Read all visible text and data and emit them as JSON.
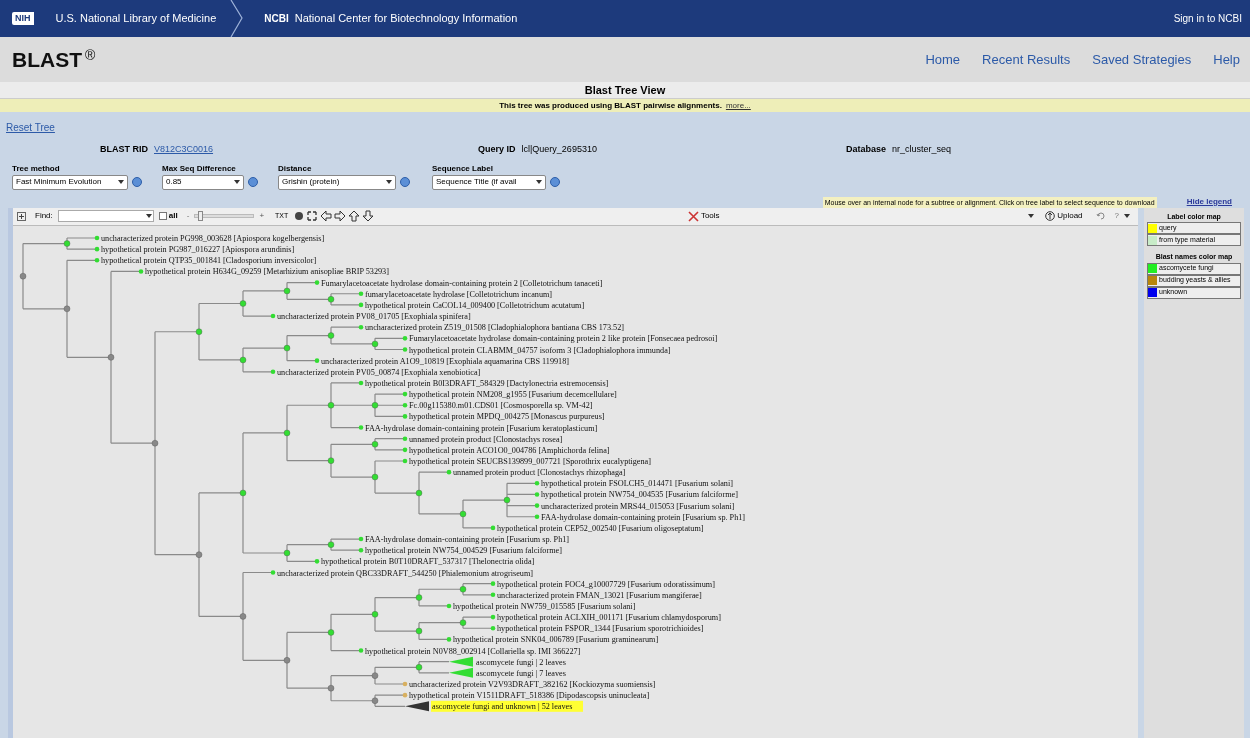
{
  "header": {
    "logo": "NIH",
    "library": "U.S. National Library of Medicine",
    "ncbi": "NCBI",
    "ncbi_name": "National Center for Biotechnology Information",
    "sign_in": "Sign in to NCBI"
  },
  "app": {
    "title": "BLAST",
    "mark": "®",
    "nav": [
      "Home",
      "Recent Results",
      "Saved Strategies",
      "Help"
    ]
  },
  "page_title": "Blast Tree View",
  "notice": {
    "text": "This tree was produced using BLAST pairwise alignments.",
    "link": "more..."
  },
  "reset": "Reset Tree",
  "info": [
    {
      "label": "BLAST RID",
      "value": "V812C3C0016",
      "kind": "link"
    },
    {
      "label": "Query ID",
      "value": "lcl|Query_2695310",
      "kind": "text"
    },
    {
      "label": "Database",
      "value": "nr_cluster_seq",
      "kind": "text"
    }
  ],
  "options": [
    {
      "label": "Tree method",
      "value": "Fast Minimum Evolution"
    },
    {
      "label": "Max Seq Difference",
      "value": "0.85"
    },
    {
      "label": "Distance",
      "value": "Grishin (protein)"
    },
    {
      "label": "Sequence Label",
      "value": "Sequence Title (if avail"
    }
  ],
  "toolbar": {
    "find_label": "Find:",
    "all_label": "all",
    "all_checked": false,
    "zoom_minus": "-",
    "zoom_plus": "+",
    "zoom": {
      "level": 0.05
    },
    "txt": "TXT",
    "hint": "Mouse over an internal node for a subtree or alignment. Click on tree label to select sequence to download",
    "hide_legend": "Hide legend",
    "tools": "Tools",
    "upload": "Upload",
    "help": "?"
  },
  "tree": {
    "color": "#888888",
    "children": [
      {
        "color": "#33dd33",
        "children": [
          {
            "label": "uncharacterized protein PG998_003628 [Apiospora kogelbergensis]",
            "color": "#33dd33",
            "query": false
          },
          {
            "label": "hypothetical protein PG987_016227 [Apiospora arundinis]",
            "color": "#33dd33",
            "query": false
          }
        ]
      },
      {
        "color": "#888888",
        "children": [
          {
            "label": "hypothetical protein QTP35_001841 [Cladosporium inversicolor]",
            "color": "#33dd33",
            "query": false
          },
          {
            "color": "#888888",
            "children": [
              {
                "label": "hypothetical protein H634G_09259 [Metarhizium anisopliae BRIP 53293]",
                "color": "#33dd33",
                "query": false
              },
              {
                "color": "#888888",
                "children": [
                  {
                    "color": "#33dd33",
                    "children": [
                      {
                        "color": "#33dd33",
                        "children": [
                          {
                            "color": "#33dd33",
                            "children": [
                              {
                                "label": "Fumarylacetoacetate hydrolase domain-containing protein 2 [Colletotrichum tanaceti]",
                                "color": "#33dd33",
                                "query": false
                              },
                              {
                                "color": "#33dd33",
                                "children": [
                                  {
                                    "label": "fumarylacetoacetate hydrolase [Colletotrichum incanum]",
                                    "color": "#33dd33",
                                    "query": false
                                  },
                                  {
                                    "label": "hypothetical protein CaCOL14_009400 [Colletotrichum acutatum]",
                                    "color": "#33dd33",
                                    "query": false
                                  }
                                ]
                              }
                            ]
                          },
                          {
                            "label": "uncharacterized protein PV08_01705 [Exophiala spinifera]",
                            "color": "#33dd33",
                            "query": false
                          }
                        ]
                      },
                      {
                        "color": "#33dd33",
                        "children": [
                          {
                            "color": "#33dd33",
                            "children": [
                              {
                                "color": "#33dd33",
                                "children": [
                                  {
                                    "label": "uncharacterized protein Z519_01508 [Cladophialophora bantiana CBS 173.52]",
                                    "color": "#33dd33",
                                    "query": false
                                  },
                                  {
                                    "color": "#33dd33",
                                    "children": [
                                      {
                                        "label": "Fumarylacetoacetate hydrolase domain-containing protein 2 like protein [Fonsecaea pedrosoi]",
                                        "color": "#33dd33",
                                        "query": false
                                      },
                                      {
                                        "label": "hypothetical protein CLABMM_04757 isoform 3 [Cladophialophora immunda]",
                                        "color": "#33dd33",
                                        "query": false
                                      }
                                    ]
                                  }
                                ]
                              },
                              {
                                "label": "uncharacterized protein A1O9_10819 [Exophiala aquamarina CBS 119918]",
                                "color": "#33dd33",
                                "query": false
                              }
                            ]
                          },
                          {
                            "label": "uncharacterized protein PV05_00874 [Exophiala xenobiotica]",
                            "color": "#33dd33",
                            "query": false
                          }
                        ]
                      }
                    ]
                  },
                  {
                    "color": "#888888",
                    "children": [
                      {
                        "color": "#33dd33",
                        "children": [
                          {
                            "color": "#33dd33",
                            "children": [
                              {
                                "color": "#33dd33",
                                "children": [
                                  {
                                    "label": "hypothetical protein B0I3DRAFT_584329 [Dactylonectria estremocensis]",
                                    "color": "#33dd33",
                                    "query": false
                                  },
                                  {
                                    "color": "#33dd33",
                                    "children": [
                                      {
                                        "label": "hypothetical protein NM208_g1955 [Fusarium decemcellulare]",
                                        "color": "#33dd33",
                                        "query": false
                                      },
                                      {
                                        "label": "Fc.00g115380.m01.CDS01 [Cosmosporella sp. VM-42]",
                                        "color": "#33dd33",
                                        "query": false
                                      },
                                      {
                                        "label": "hypothetical protein MPDQ_004275 [Monascus purpureus]",
                                        "color": "#33dd33",
                                        "query": false
                                      }
                                    ]
                                  },
                                  {
                                    "label": "FAA-hydrolase domain-containing protein [Fusarium keratoplasticum]",
                                    "color": "#33dd33",
                                    "query": false
                                  }
                                ]
                              },
                              {
                                "color": "#33dd33",
                                "children": [
                                  {
                                    "color": "#33dd33",
                                    "children": [
                                      {
                                        "label": "unnamed protein product [Clonostachys rosea]",
                                        "color": "#33dd33",
                                        "query": false
                                      },
                                      {
                                        "label": "hypothetical protein ACO1O0_004786 [Amphichorda felina]",
                                        "color": "#33dd33",
                                        "query": false
                                      }
                                    ]
                                  },
                                  {
                                    "color": "#33dd33",
                                    "children": [
                                      {
                                        "label": "hypothetical protein SEUCBS139899_007721 [Sporothrix eucalyptigena]",
                                        "color": "#33dd33",
                                        "query": false
                                      },
                                      {
                                        "color": "#33dd33",
                                        "children": [
                                          {
                                            "label": "unnamed protein product [Clonostachys rhizophaga]",
                                            "color": "#33dd33",
                                            "query": false
                                          },
                                          {
                                            "color": "#33dd33",
                                            "children": [
                                              {
                                                "color": "#33dd33",
                                                "children": [
                                                  {
                                                    "label": "hypothetical protein FSOLCH5_014471 [Fusarium solani]",
                                                    "color": "#33dd33",
                                                    "query": false
                                                  },
                                                  {
                                                    "label": "hypothetical protein NW754_004535 [Fusarium falciforme]",
                                                    "color": "#33dd33",
                                                    "query": false
                                                  },
                                                  {
                                                    "label": "uncharacterized protein MRS44_015053 [Fusarium solani]",
                                                    "color": "#33dd33",
                                                    "query": false
                                                  },
                                                  {
                                                    "label": "FAA-hydrolase domain-containing protein [Fusarium sp. Ph1]",
                                                    "color": "#33dd33",
                                                    "query": false
                                                  }
                                                ]
                                              },
                                              {
                                                "label": "hypothetical protein CEP52_002540 [Fusarium oligoseptatum]",
                                                "color": "#33dd33",
                                                "query": false
                                              }
                                            ]
                                          }
                                        ]
                                      }
                                    ]
                                  }
                                ]
                              }
                            ]
                          },
                          {
                            "color": "#33dd33",
                            "children": [
                              {
                                "color": "#33dd33",
                                "children": [
                                  {
                                    "label": "FAA-hydrolase domain-containing protein [Fusarium sp. Ph1]",
                                    "color": "#33dd33",
                                    "query": false
                                  },
                                  {
                                    "label": "hypothetical protein NW754_004529 [Fusarium falciforme]",
                                    "color": "#33dd33",
                                    "query": false
                                  }
                                ]
                              },
                              {
                                "label": "hypothetical protein B0T10DRAFT_537317 [Thelonectria olida]",
                                "color": "#33dd33",
                                "query": false
                              }
                            ]
                          }
                        ]
                      },
                      {
                        "color": "#888888",
                        "children": [
                          {
                            "label": "uncharacterized protein QBC33DRAFT_544250 [Phialemonium atrogriseum]",
                            "color": "#33dd33",
                            "query": false
                          },
                          {
                            "color": "#888888",
                            "children": [
                              {
                                "color": "#33dd33",
                                "children": [
                                  {
                                    "color": "#33dd33",
                                    "children": [
                                      {
                                        "color": "#33dd33",
                                        "children": [
                                          {
                                            "color": "#33dd33",
                                            "children": [
                                              {
                                                "label": "hypothetical protein FOC4_g10007729 [Fusarium odoratissimum]",
                                                "color": "#33dd33",
                                                "query": false
                                              },
                                              {
                                                "label": "uncharacterized protein FMAN_13021 [Fusarium mangiferae]",
                                                "color": "#33dd33",
                                                "query": false
                                              }
                                            ]
                                          },
                                          {
                                            "label": "hypothetical protein NW759_015585 [Fusarium solani]",
                                            "color": "#33dd33",
                                            "query": false
                                          }
                                        ]
                                      },
                                      {
                                        "color": "#33dd33",
                                        "children": [
                                          {
                                            "color": "#33dd33",
                                            "children": [
                                              {
                                                "label": "hypothetical protein ACLXIH_001171 [Fusarium chlamydosporum]",
                                                "color": "#33dd33",
                                                "query": false
                                              },
                                              {
                                                "label": "hypothetical protein FSPOR_1344 [Fusarium sporotrichioides]",
                                                "color": "#33dd33",
                                                "query": false
                                              }
                                            ]
                                          },
                                          {
                                            "label": "hypothetical protein SNK04_006789 [Fusarium graminearum]",
                                            "color": "#33dd33",
                                            "query": false
                                          }
                                        ]
                                      }
                                    ]
                                  },
                                  {
                                    "label": "hypothetical protein N0V88_002914 [Collariella sp. IMI 366227]",
                                    "color": "#33dd33",
                                    "query": false
                                  }
                                ]
                              },
                              {
                                "color": "#888888",
                                "children": [
                                  {
                                    "color": "#888888",
                                    "children": [
                                      {
                                        "color": "#33dd33",
                                        "children": [
                                          {
                                            "kind": "collapsed",
                                            "label": "ascomycete fungi | 2 leaves",
                                            "color": "#33dd33",
                                            "query": false
                                          },
                                          {
                                            "kind": "collapsed",
                                            "label": "ascomycete fungi | 7 leaves",
                                            "color": "#33dd33",
                                            "query": false
                                          }
                                        ]
                                      },
                                      {
                                        "label": "uncharacterized protein V2V93DRAFT_382162 [Kockiozyma suomiensis]",
                                        "color": "#d8b060",
                                        "query": false
                                      }
                                    ]
                                  },
                                  {
                                    "color": "#888888",
                                    "children": [
                                      {
                                        "label": "hypothetical protein V1511DRAFT_518386 [Dipodascopsis uninucleata]",
                                        "color": "#d8b060",
                                        "query": false
                                      },
                                      {
                                        "kind": "collapsed",
                                        "label": "ascomycete fungi and unknown | 52 leaves",
                                        "color": "#333333",
                                        "query": true
                                      }
                                    ]
                                  }
                                ]
                              }
                            ]
                          }
                        ]
                      }
                    ]
                  }
                ]
              }
            ]
          }
        ]
      }
    ]
  },
  "legend": {
    "sections": [
      {
        "title": "Label color map",
        "items": [
          {
            "label": "query",
            "color": "#ffff00"
          },
          {
            "label": "from type material",
            "color": "#c8ecc8"
          }
        ]
      },
      {
        "title": "Blast names color map",
        "items": [
          {
            "label": "ascomycete fungi",
            "color": "#22ee22"
          },
          {
            "label": "budding yeasts & allies",
            "color": "#b8860b"
          },
          {
            "label": "unknown",
            "color": "#0000ee"
          }
        ]
      }
    ]
  }
}
